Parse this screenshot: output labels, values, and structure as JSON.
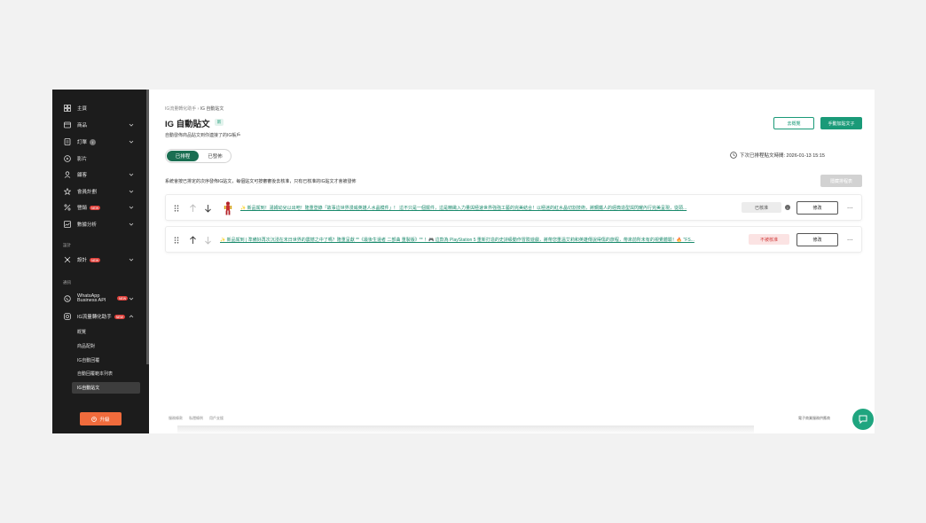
{
  "sidebar": {
    "items": [
      {
        "label": "主頁",
        "icon": "dashboard-icon",
        "chevron": false
      },
      {
        "label": "商品",
        "icon": "product-icon",
        "chevron": true
      },
      {
        "label": "訂單",
        "icon": "order-icon",
        "chevron": true,
        "info": "i"
      },
      {
        "label": "影片",
        "icon": "video-icon",
        "chevron": false
      },
      {
        "label": "顧客",
        "icon": "customer-icon",
        "chevron": true
      },
      {
        "label": "會員計劃",
        "icon": "star-icon",
        "chevron": true
      },
      {
        "label": "營銷",
        "icon": "percent-icon",
        "chevron": true,
        "badge": "NEW"
      },
      {
        "label": "數據分析",
        "icon": "analytics-icon",
        "chevron": true
      }
    ],
    "section_design": "設計",
    "design_item": {
      "label": "設計",
      "badge": "NEW"
    },
    "section_channel": "通訊",
    "whatsapp_line1": "WhatsApp",
    "whatsapp_line2": "Business API",
    "whatsapp_badge": "NEW",
    "ig_item": {
      "label": "IG流量轉化助手",
      "badge": "NEW"
    },
    "ig_sub": [
      "概覽",
      "商品配對",
      "IG自動回覆",
      "自動回覆範本列表",
      "IG自動貼文"
    ],
    "upgrade_label": "升級"
  },
  "breadcrumb": {
    "parent": "IG流量轉化助手",
    "sep": "›",
    "current": "IG 自動貼文"
  },
  "page": {
    "title": "IG 自動貼文",
    "title_badge": "新",
    "description": "自動發佈商品貼文到你連接了的IG帳戶",
    "preview_button": "去概覽",
    "add_button": "手動加貼文子"
  },
  "toggle": {
    "scheduled": "已排程",
    "published": "已發佈"
  },
  "schedule": {
    "label": "下次已排程貼文時間: 2026-01-13 15:15",
    "button": "設定"
  },
  "notice": "系統會按已排定的次序發佈IG貼文，每個貼文可按審審後去核准，只有已核准的IG貼文才會被發佈",
  "bulk_button": "隱藏排程表",
  "posts": [
    {
      "text": "✨ 新品駕到！湯姆幼兒以出吧！隆重登錄「故事這世界漫威英雄人水晶模件」！ 這不只是一個擺件，這是精緻入力量與極速世界強強工藝的完美結合！以極迷的紅水晶切割技術，將鋼鐵人的經典造型與閃耀內行完美呈現，從頭...",
      "status": "已核准",
      "edit": "修改",
      "more": "···"
    },
    {
      "text": "✨ 新品駕到 | 準備好再次沉浸在末日世界的震撼之中了嗎？隆重呈獻 **《最後生還者 二部曲 重製版》** ！🎮 這款為 PlayStation 5 重新打造的史詩級動作冒險遊戲，將帶您重溫艾莉和英雄傳說得傷的旅程，帶來前所未有的視覺體驗！🔥 \"FS...",
      "status": "不被核准",
      "edit": "修改",
      "more": "···"
    }
  ],
  "footer": {
    "links": [
      "服務條款",
      "私隱條例",
      "用戶支援"
    ],
    "right": "電子商業服務供應商"
  },
  "colors": {
    "accent": "#1a9a78",
    "sidebar": "#1c1c1c",
    "upgrade": "#f06b3c",
    "reject": "#d23c3c"
  }
}
